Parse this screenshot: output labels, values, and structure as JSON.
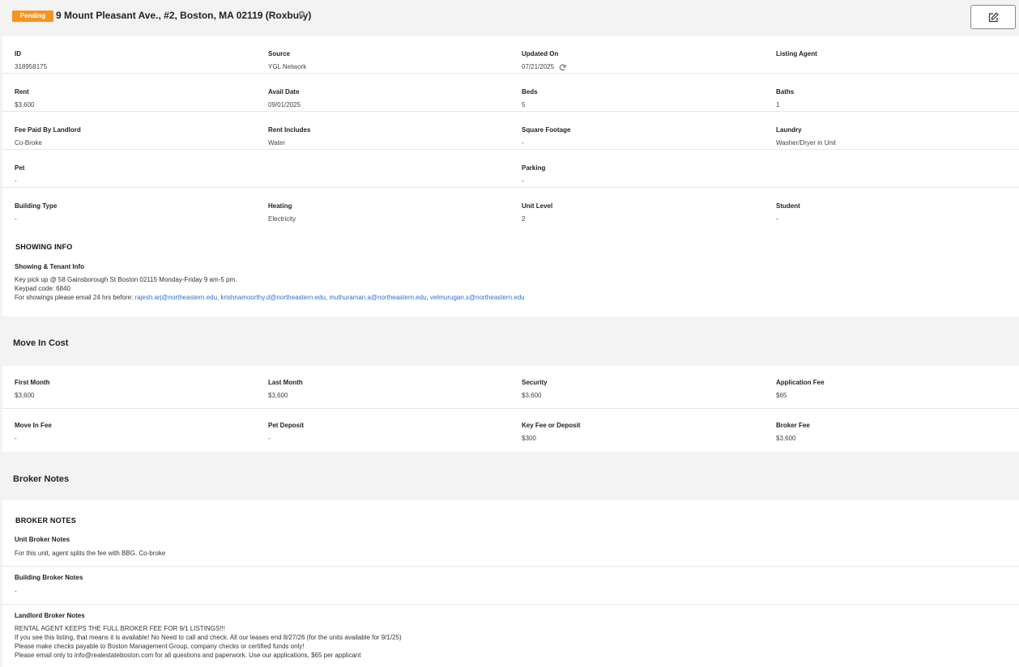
{
  "header": {
    "status": "Pending",
    "address": "9 Mount Pleasant Ave., #2, Boston, MA 02119 (Roxbury)",
    "status_color": "#f7941d"
  },
  "details": [
    [
      {
        "label": "ID",
        "value": "318958175"
      },
      {
        "label": "Source",
        "value": "YGL Network"
      },
      {
        "label": "Updated On",
        "value": "07/21/2025"
      },
      {
        "label": "Listing Agent",
        "value": ""
      }
    ],
    [
      {
        "label": "Rent",
        "value": "$3,600"
      },
      {
        "label": "Avail Date",
        "value": "09/01/2025"
      },
      {
        "label": "Beds",
        "value": "5"
      },
      {
        "label": "Baths",
        "value": "1"
      }
    ],
    [
      {
        "label": "Fee Paid By Landlord",
        "value": "Co-Broke"
      },
      {
        "label": "Rent Includes",
        "value": "Water"
      },
      {
        "label": "Square Footage",
        "value": "-"
      },
      {
        "label": "Laundry",
        "value": "Washer/Dryer in Unit"
      }
    ],
    [
      {
        "label": "Pet",
        "value": "-"
      },
      {
        "label": "",
        "value": ""
      },
      {
        "label": "Parking",
        "value": "-"
      },
      {
        "label": "",
        "value": ""
      }
    ],
    [
      {
        "label": "Building Type",
        "value": "-"
      },
      {
        "label": "Heating",
        "value": "Electricity"
      },
      {
        "label": "Unit Level",
        "value": "2"
      },
      {
        "label": "Student",
        "value": "-"
      }
    ]
  ],
  "showing": {
    "title": "SHOWING INFO",
    "label": "Showing & Tenant Info",
    "line1": "Key pick up @ 58 Gainsborough St Boston 02115 Monday-Friday 9 am-5 pm.",
    "line2": "Keypad code: 6840",
    "line3_prefix": "For showings please email 24 hrs before: ",
    "emails": [
      "rajesh.arj@northeastern.edu",
      "krishnamoorthy.d@northeastern.edu",
      "muthuraman.a@northeastern.edu",
      "velmurugan.s@northeastern.edu"
    ]
  },
  "move_in": {
    "title": "Move In Cost",
    "rows": [
      [
        {
          "label": "First Month",
          "value": "$3,600"
        },
        {
          "label": "Last Month",
          "value": "$3,600"
        },
        {
          "label": "Security",
          "value": "$3,600"
        },
        {
          "label": "Application Fee",
          "value": "$65"
        }
      ],
      [
        {
          "label": "Move In Fee",
          "value": "-"
        },
        {
          "label": "Pet Deposit",
          "value": "-"
        },
        {
          "label": "Key Fee or Deposit",
          "value": "$300"
        },
        {
          "label": "Broker Fee",
          "value": "$3,600"
        }
      ]
    ]
  },
  "broker": {
    "title": "Broker Notes",
    "subtitle": "BROKER NOTES",
    "unit_label": "Unit Broker Notes",
    "unit_value": "For this unit, agent splits the fee with BBG. Co-broke",
    "building_label": "Building Broker Notes",
    "building_value": "-",
    "landlord_label": "Landlord Broker Notes",
    "landlord_lines": [
      "RENTAL AGENT KEEPS THE FULL BROKER FEE FOR 9/1 LISTINGS!!!",
      "If you see this listing, that means it is available! No Need to call and check. All our leases end 8/27/26 (for the units available for 9/1/25)",
      "Please make checks payable to Boston Management Group, company checks or certified funds only!",
      "Please email only to info@realestateboston.com for all questions and paperwork. Use our applications, $65 per applicant"
    ]
  }
}
